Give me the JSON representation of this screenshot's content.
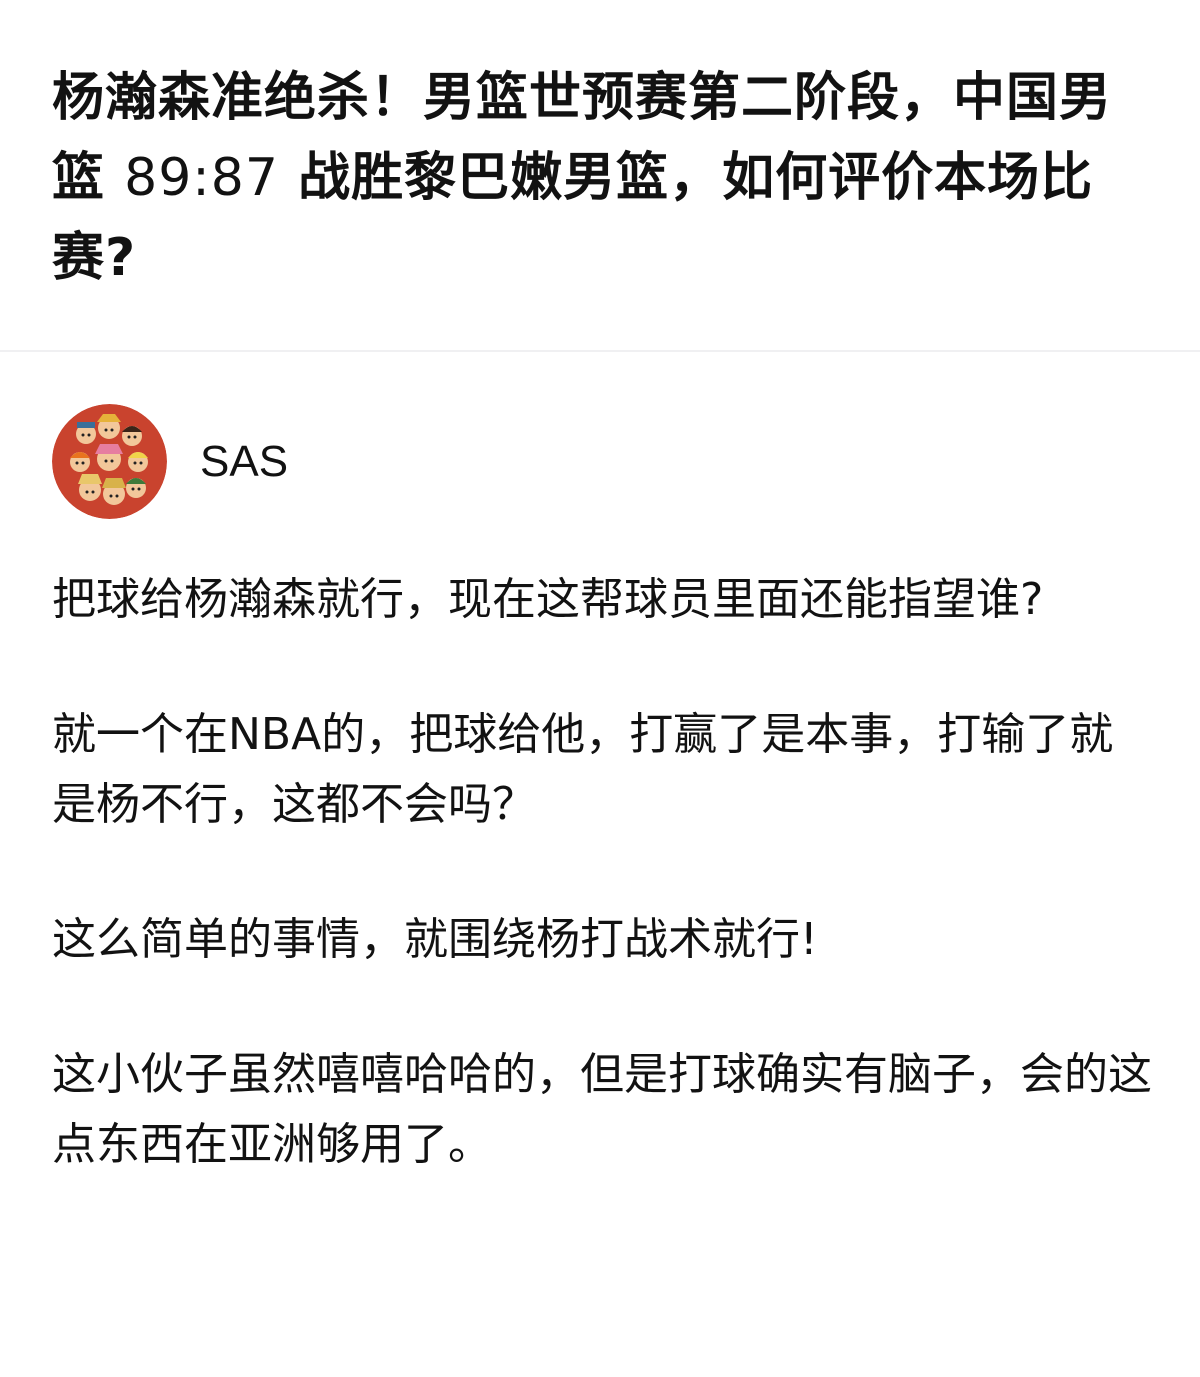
{
  "question": {
    "title_part1": "杨瀚森准绝杀！男篮世预赛第二阶段，中国男篮 ",
    "title_score": "89:87",
    "title_part2": " 战胜黎巴嫩男篮，如何评价本场比赛?"
  },
  "author": {
    "name": "SAS",
    "avatar_icon": "cartoon-group-avatar-icon"
  },
  "answer": {
    "paragraphs": [
      "把球给杨瀚森就行，现在这帮球员里面还能指望谁?",
      "就一个在NBA的，把球给他，打赢了是本事，打输了就是杨不行，这都不会吗？",
      "这么简单的事情，就围绕杨打战术就行!",
      "这小伙子虽然嘻嘻哈哈的，但是打球确实有脑子，会的这点东西在亚洲够用了。"
    ]
  },
  "colors": {
    "text": "#121212",
    "divider": "#f0f0f2",
    "avatar_bg": "#c9432e"
  }
}
